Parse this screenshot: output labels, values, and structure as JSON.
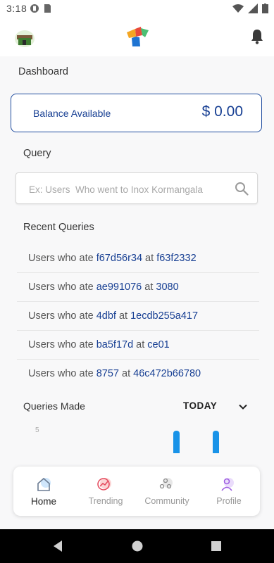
{
  "status_bar": {
    "time": "3:18"
  },
  "header": {
    "avatar_icon": "avatar-icon",
    "logo_icon": "app-logo",
    "bell_icon": "bell-icon"
  },
  "dashboard": {
    "title": "Dashboard"
  },
  "balance": {
    "label": "Balance Available",
    "amount": "$ 0.00"
  },
  "query": {
    "label": "Query",
    "placeholder": "Ex: Users  Who went to Inox Kormangala"
  },
  "recent": {
    "label": "Recent Queries",
    "items": [
      {
        "prefix": "Users who ate ",
        "a": "f67d56r34",
        "mid": " at ",
        "b": "f63f2332"
      },
      {
        "prefix": "Users who ate ",
        "a": "ae991076",
        "mid": " at ",
        "b": "3080"
      },
      {
        "prefix": "Users who ate ",
        "a": "4dbf",
        "mid": " at ",
        "b": "1ecdb255a417"
      },
      {
        "prefix": "Users who ate ",
        "a": "ba5f17d",
        "mid": " at ",
        "b": "ce01"
      },
      {
        "prefix": "Users who ate ",
        "a": "8757",
        "mid": " at ",
        "b": "46c472b66780"
      }
    ]
  },
  "queries_made": {
    "label": "Queries Made",
    "period": "TODAY"
  },
  "chart_data": {
    "type": "bar",
    "y_tick": "5"
  },
  "bottom_nav": [
    {
      "label": "Home",
      "icon": "home-icon",
      "active": true
    },
    {
      "label": "Trending",
      "icon": "trending-icon",
      "active": false
    },
    {
      "label": "Community",
      "icon": "community-icon",
      "active": false
    },
    {
      "label": "Profile",
      "icon": "profile-icon",
      "active": false
    }
  ],
  "colors": {
    "accent": "#173f93",
    "bar": "#1993e8"
  }
}
